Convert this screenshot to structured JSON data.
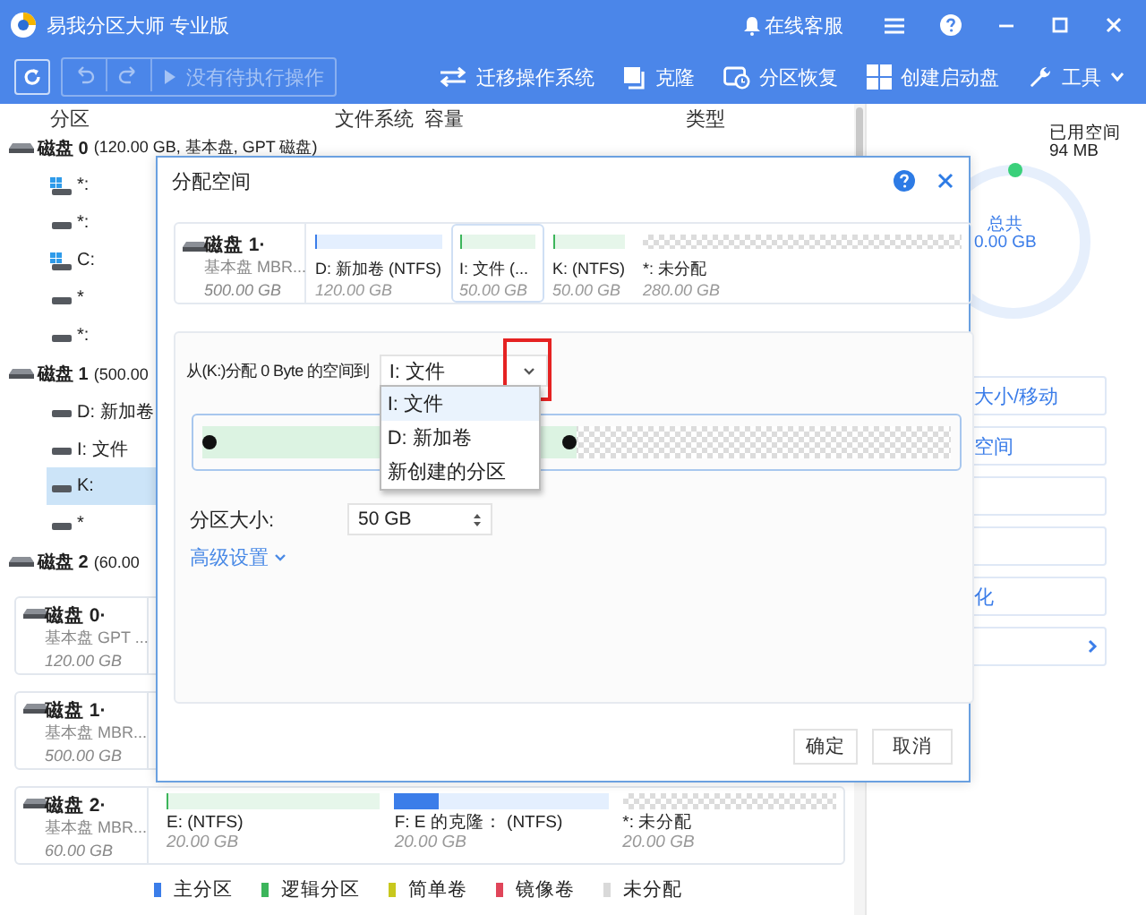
{
  "window": {
    "title": "易我分区大师 专业版",
    "support": "在线客服"
  },
  "toolbar": {
    "pending": {
      "label": "没有待执行操作",
      "disabled": true
    },
    "actions": [
      {
        "kind": "migrate",
        "label": "迁移操作系统"
      },
      {
        "kind": "clone",
        "label": "克隆"
      },
      {
        "kind": "recover",
        "label": "分区恢复"
      },
      {
        "kind": "bootdisk",
        "label": "创建启动盘"
      },
      {
        "kind": "tools",
        "label": "工具"
      }
    ]
  },
  "tree": {
    "columns": [
      "分区",
      "文件系统",
      "容量",
      "类型"
    ],
    "disks": [
      {
        "name": "磁盘 0",
        "info": "(120.00 GB, 基本盘, GPT 磁盘)",
        "children": [
          {
            "label": "*:",
            "kind": "system",
            "selected": false
          },
          {
            "label": "*:",
            "kind": "plain",
            "selected": false
          },
          {
            "label": "C:",
            "kind": "system",
            "selected": false
          },
          {
            "label": "*",
            "kind": "plain",
            "selected": false
          },
          {
            "label": "*:",
            "kind": "plain",
            "selected": false
          }
        ]
      },
      {
        "name": "磁盘 1",
        "info": "(500.00",
        "children": [
          {
            "label": "D: 新加卷",
            "kind": "plain",
            "selected": false
          },
          {
            "label": "I: 文件",
            "kind": "plain",
            "selected": false
          },
          {
            "label": "K:",
            "kind": "plain",
            "selected": true
          },
          {
            "label": "*",
            "kind": "plain",
            "selected": false
          }
        ]
      },
      {
        "name": "磁盘 2",
        "info": "(60.00"
      }
    ]
  },
  "cards": [
    {
      "name": "磁盘 0·",
      "type": "基本盘 GPT ...",
      "size": "120.00 GB"
    },
    {
      "name": "磁盘 1·",
      "type": "基本盘 MBR...",
      "size": "500.00 GB"
    },
    {
      "name": "磁盘 2·",
      "type": "基本盘 MBR...",
      "size": "60.00 GB",
      "partitions": [
        {
          "label": "E:  (NTFS)",
          "size": "20.00 GB",
          "kind": "logical"
        },
        {
          "label": "F: E 的克隆：  (NTFS)",
          "size": "20.00 GB",
          "kind": "primary",
          "level": 0.21
        },
        {
          "label": "*: 未分配",
          "size": "20.00 GB",
          "kind": "unallocated"
        }
      ]
    }
  ],
  "legend": [
    {
      "label": "主分区",
      "color": "#3b7de9"
    },
    {
      "label": "逻辑分区",
      "color": "#3cb55b"
    },
    {
      "label": "简单卷",
      "color": "#c8c81e"
    },
    {
      "label": "镜像卷",
      "color": "#e0455a"
    },
    {
      "label": "未分配",
      "color": "#d9d9d9"
    }
  ],
  "side": {
    "used_label": "已用空间",
    "used": "94 MB",
    "total_label": "总共",
    "total": "0.00 GB",
    "actions": [
      {
        "kind": "text",
        "label": "大小/移动"
      },
      {
        "kind": "text",
        "label": "空间"
      },
      {
        "kind": "blank"
      },
      {
        "kind": "blank"
      },
      {
        "kind": "text",
        "label": "化"
      },
      {
        "kind": "more"
      }
    ]
  },
  "dialog": {
    "title": "分配空间",
    "disk": {
      "name": "磁盘 1·",
      "type": "基本盘 MBR...",
      "size": "500.00 GB",
      "partitions": [
        {
          "label": "D: 新加卷 (NTFS)",
          "size": "120.00 GB",
          "kind": "primary",
          "selected": false
        },
        {
          "label": "I: 文件 (...",
          "size": "50.00 GB",
          "kind": "logical",
          "selected": true
        },
        {
          "label": "K:  (NTFS)",
          "size": "50.00 GB",
          "kind": "logical",
          "selected": false
        },
        {
          "label": "*: 未分配",
          "size": "280.00 GB",
          "kind": "unallocated",
          "selected": false
        }
      ]
    },
    "allocate_label": "从(K:)分配 0 Byte 的空间到",
    "target": {
      "value": "I: 文件",
      "expanded": true,
      "options": [
        {
          "label": "I: 文件",
          "selected": true
        },
        {
          "label": "D: 新加卷",
          "selected": false
        },
        {
          "label": "新创建的分区",
          "selected": false
        }
      ]
    },
    "slider": {
      "level": 0.5
    },
    "size_label": "分区大小:",
    "size_value": "50 GB",
    "advanced": "高级设置",
    "buttons": [
      "确定",
      "取消"
    ]
  }
}
